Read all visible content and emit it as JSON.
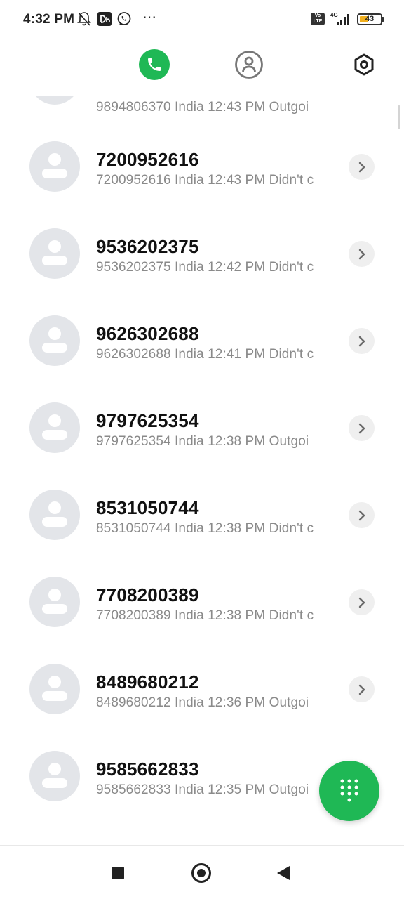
{
  "status_bar": {
    "time": "4:32 PM",
    "icons": [
      "bell-off-icon",
      "dh-app-icon",
      "whatsapp-icon",
      "more-dots-icon",
      "volte-icon",
      "signal-4g-icon",
      "battery-icon"
    ],
    "more_dots": "⋯",
    "volte_line1": "Vo",
    "volte_line2": "LTE",
    "network": "4G",
    "battery_level": "43",
    "battery_fraction": 0.43,
    "battery_color": "#f2b01e"
  },
  "top_tabs": {
    "items": [
      "phone-tab",
      "contacts-tab",
      "settings-tab"
    ],
    "accent_color": "#1fb855"
  },
  "calls": [
    {
      "number": "",
      "detail": "9894806370 India  12:43 PM Outgoi"
    },
    {
      "number": "7200952616",
      "detail": "7200952616 India  12:43 PM Didn't c"
    },
    {
      "number": "9536202375",
      "detail": "9536202375 India  12:42 PM Didn't c"
    },
    {
      "number": "9626302688",
      "detail": "9626302688 India  12:41 PM Didn't c"
    },
    {
      "number": "9797625354",
      "detail": "9797625354 India  12:38 PM Outgoi"
    },
    {
      "number": "8531050744",
      "detail": "8531050744 India  12:38 PM Didn't c"
    },
    {
      "number": "7708200389",
      "detail": "7708200389 India  12:38 PM Didn't c"
    },
    {
      "number": "8489680212",
      "detail": "8489680212 India  12:36 PM Outgoi"
    },
    {
      "number": "9585662833",
      "detail": "9585662833 India  12:35 PM Outgoi"
    }
  ],
  "fab": {
    "icon": "dialpad-icon"
  },
  "nav_bar": {
    "items": [
      "recents-button",
      "home-button",
      "back-button"
    ]
  }
}
